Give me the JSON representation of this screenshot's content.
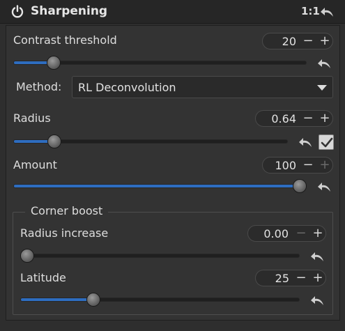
{
  "header": {
    "title": "Sharpening",
    "ratio_label": "1:1"
  },
  "contrast_threshold": {
    "label": "Contrast threshold",
    "value": "20",
    "minus": "−",
    "plus": "+",
    "slider_fraction": 0.12
  },
  "method": {
    "label": "Method:",
    "value": "RL Deconvolution"
  },
  "radius": {
    "label": "Radius",
    "value": "0.64",
    "minus": "−",
    "plus": "+",
    "slider_fraction": 0.13,
    "checkbox_checked": true
  },
  "amount": {
    "label": "Amount",
    "value": "100",
    "minus": "−",
    "plus": "+",
    "slider_fraction": 1.0
  },
  "corner_boost": {
    "title": "Corner boost",
    "radius_increase": {
      "label": "Radius increase",
      "value": "0.00",
      "minus": "−",
      "plus": "+",
      "slider_fraction": 0.0
    },
    "latitude": {
      "label": "Latitude",
      "value": "25",
      "minus": "−",
      "plus": "+",
      "slider_fraction": 0.25
    }
  },
  "colors": {
    "accent": "#2e6dc0",
    "background": "#2e2e2e"
  }
}
